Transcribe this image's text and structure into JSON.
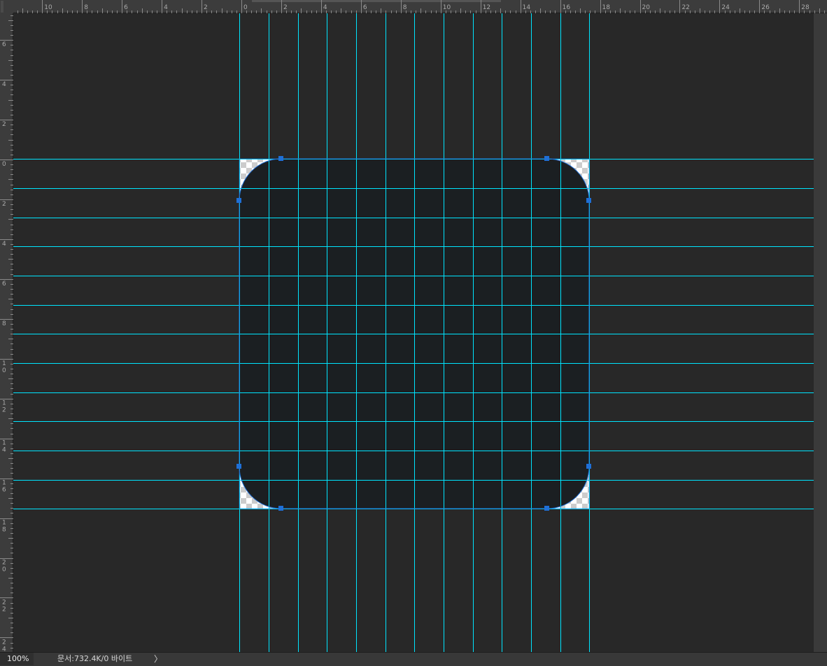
{
  "rulers": {
    "horizontal_labels": [
      "10",
      "8",
      "6",
      "4",
      "2",
      "0",
      "2",
      "4",
      "6",
      "8",
      "10",
      "12",
      "14",
      "16",
      "18",
      "20",
      "22",
      "24",
      "26",
      "28"
    ],
    "vertical_labels": [
      "6",
      "4",
      "2",
      "0",
      "2",
      "4",
      "6",
      "8",
      "10",
      "12",
      "14",
      "16",
      "18",
      "20",
      "22",
      "24"
    ]
  },
  "status_bar": {
    "zoom": "100%",
    "doc_info": "문서:732.4K/0 바이트",
    "arrow": "〉"
  },
  "colors": {
    "workspace": "#282828",
    "ruler": "#3c3c3c",
    "ruler_text": "#a9a9a9",
    "guide": "#00e5ff",
    "shape_fill": "#1b1f22",
    "path": "#1f6fd6",
    "anchor": "#1f6fd6"
  }
}
